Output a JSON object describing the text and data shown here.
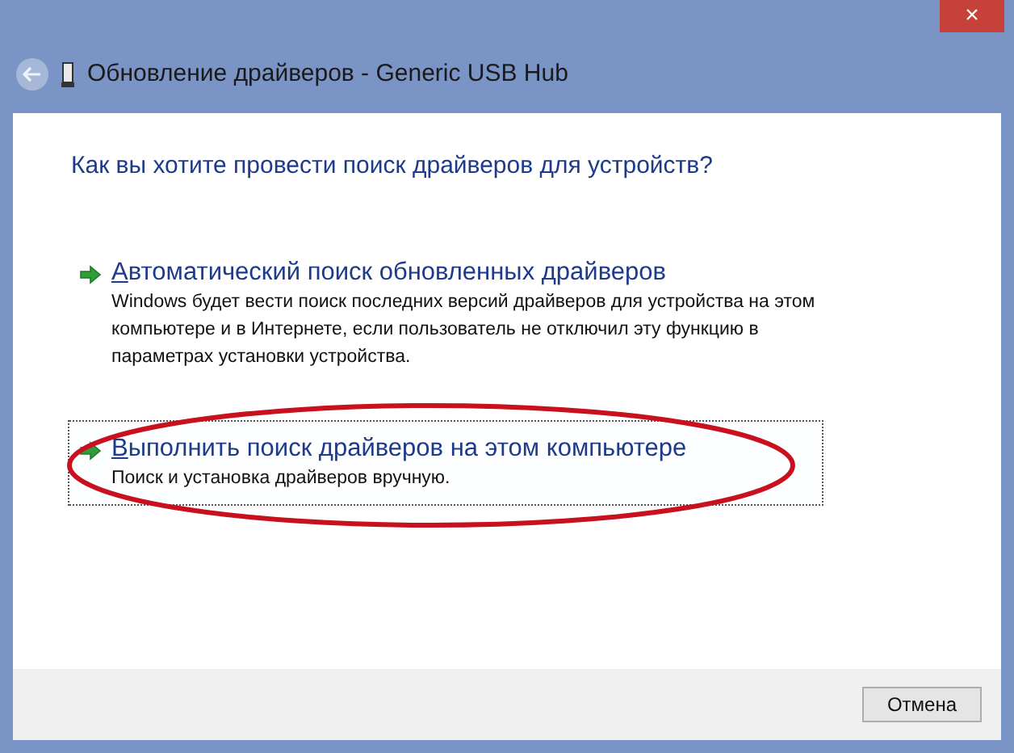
{
  "window": {
    "title": "Обновление драйверов - Generic USB Hub",
    "close": "×"
  },
  "question": "Как вы хотите провести поиск драйверов для устройств?",
  "options": [
    {
      "title": "Автоматический поиск обновленных драйверов",
      "description": "Windows будет вести поиск последних версий драйверов для устройства на этом компьютере и в Интернете, если пользователь не отключил эту функцию в параметрах установки устройства.",
      "selected": false
    },
    {
      "title": "Выполнить поиск драйверов на этом компьютере",
      "description": "Поиск и установка драйверов вручную.",
      "selected": true
    }
  ],
  "buttons": [
    "Отмена"
  ]
}
